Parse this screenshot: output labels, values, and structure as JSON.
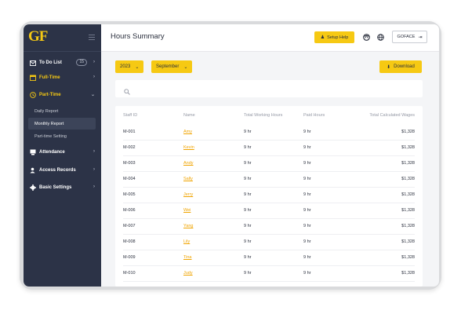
{
  "app": {
    "logo": "GF"
  },
  "sidebar": {
    "items": [
      {
        "label": "To Do List",
        "badge": "15",
        "icon": "inbox-icon",
        "color": "#ffffff"
      },
      {
        "label": "Full-Time",
        "icon": "calendar-icon",
        "color": "#f6c913"
      },
      {
        "label": "Part-Time",
        "icon": "clock-icon",
        "color": "#f6c913",
        "expanded": true,
        "subitems": [
          "Daily Report",
          "Monthly Report",
          "Part-time Setting"
        ],
        "active_subitem": "Monthly Report"
      },
      {
        "label": "Attendance",
        "icon": "attendance-icon",
        "color": "#ffffff"
      },
      {
        "label": "Access Records",
        "icon": "user-icon",
        "color": "#ffffff"
      },
      {
        "label": "Basic Settings",
        "icon": "gear-icon",
        "color": "#ffffff"
      }
    ]
  },
  "header": {
    "title": "Hours Summary",
    "setup_help": "Setup Help",
    "goface": "GOFACE"
  },
  "filters": {
    "year": "2023",
    "month": "September",
    "download": "Download"
  },
  "search": {
    "placeholder": ""
  },
  "table": {
    "columns": [
      "Staff ID",
      "Name",
      "Total Working Hours",
      "Paid Hours",
      "Total Calculated Wages"
    ],
    "rows": [
      [
        "M-001",
        "Amy",
        "9 hr",
        "9 hr",
        "$1,328"
      ],
      [
        "M-002",
        "Kevin",
        "9 hr",
        "9 hr",
        "$1,328"
      ],
      [
        "M-003",
        "Andy",
        "9 hr",
        "9 hr",
        "$1,328"
      ],
      [
        "M-004",
        "Sally",
        "9 hr",
        "9 hr",
        "$1,328"
      ],
      [
        "M-005",
        "Jerry",
        "9 hr",
        "9 hr",
        "$1,328"
      ],
      [
        "M-006",
        "Wei",
        "9 hr",
        "9 hr",
        "$1,328"
      ],
      [
        "M-007",
        "Yang",
        "9 hr",
        "9 hr",
        "$1,328"
      ],
      [
        "M-008",
        "Lily",
        "9 hr",
        "9 hr",
        "$1,328"
      ],
      [
        "M-009",
        "Tina",
        "9 hr",
        "9 hr",
        "$1,328"
      ],
      [
        "M-010",
        "Judy",
        "9 hr",
        "9 hr",
        "$1,328"
      ]
    ]
  },
  "colors": {
    "accent": "#f6c913",
    "sidebar": "#2c3347",
    "link": "#f0a400"
  }
}
